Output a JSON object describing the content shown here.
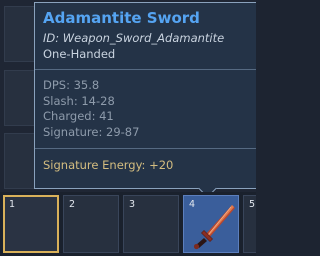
{
  "tooltip": {
    "title": "Adamantite Sword",
    "id_line": "ID: Weapon_Sword_Adamantite",
    "type": "One-Handed",
    "stats": {
      "dps": "DPS: 35.8",
      "slash": "Slash: 14-28",
      "charged": "Charged: 41",
      "signature": "Signature: 29-87"
    },
    "signature_energy": "Signature Energy: +20"
  },
  "hotbar": {
    "slots": [
      {
        "number": "1",
        "item": "",
        "selected": true
      },
      {
        "number": "2",
        "item": ""
      },
      {
        "number": "3",
        "item": ""
      },
      {
        "number": "4",
        "item": "sword-icon",
        "equipped": true
      },
      {
        "number": "5",
        "item": ""
      }
    ]
  },
  "colors": {
    "title": "#55a4f2",
    "signature_energy": "#d4bd80",
    "selected_border": "#d9b15a",
    "equipped_slot": "#3a5e9b"
  }
}
